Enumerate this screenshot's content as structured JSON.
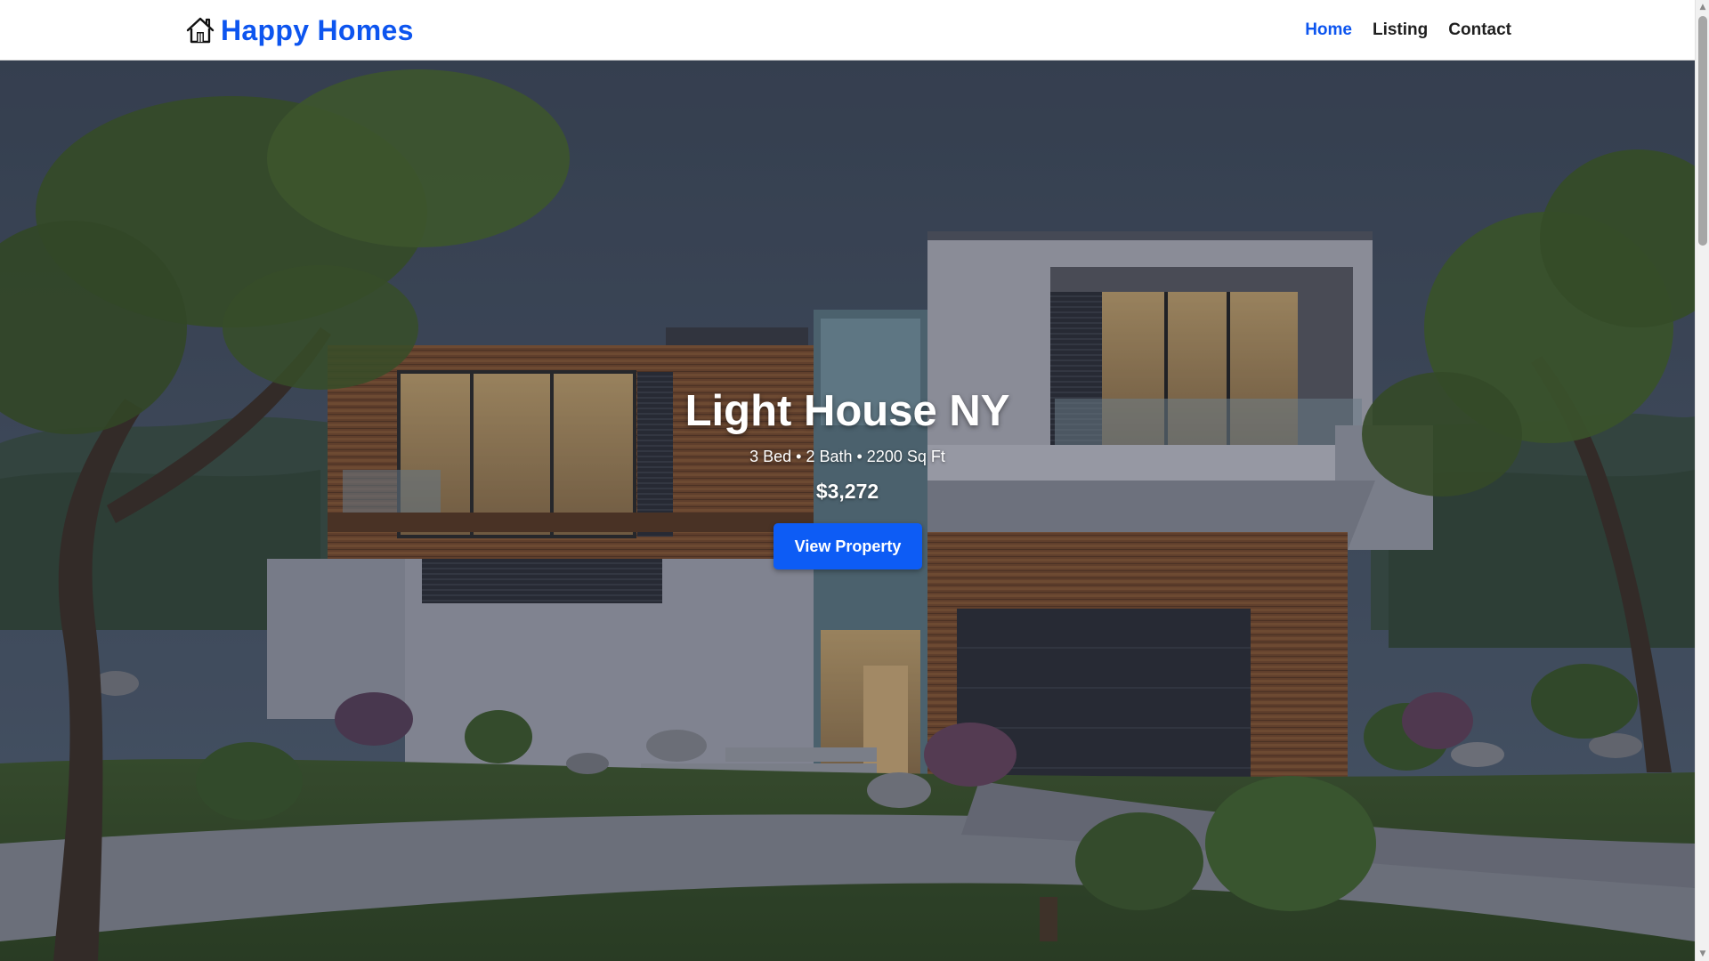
{
  "brand": {
    "name": "Happy Homes",
    "icon": "house-icon",
    "color": "#0d55ef"
  },
  "nav": {
    "items": [
      {
        "label": "Home",
        "active": true
      },
      {
        "label": "Listing",
        "active": false
      },
      {
        "label": "Contact",
        "active": false
      }
    ]
  },
  "hero": {
    "title": "Light House NY",
    "specs": "3 Bed • 2 Bath • 2200 Sq Ft",
    "price": "$3,272",
    "button_label": "View Property",
    "button_color": "#0d5cf5",
    "background": "modern-house-photo"
  },
  "colors": {
    "accent": "#0d55ef",
    "nav_text": "#1f1f1f"
  }
}
